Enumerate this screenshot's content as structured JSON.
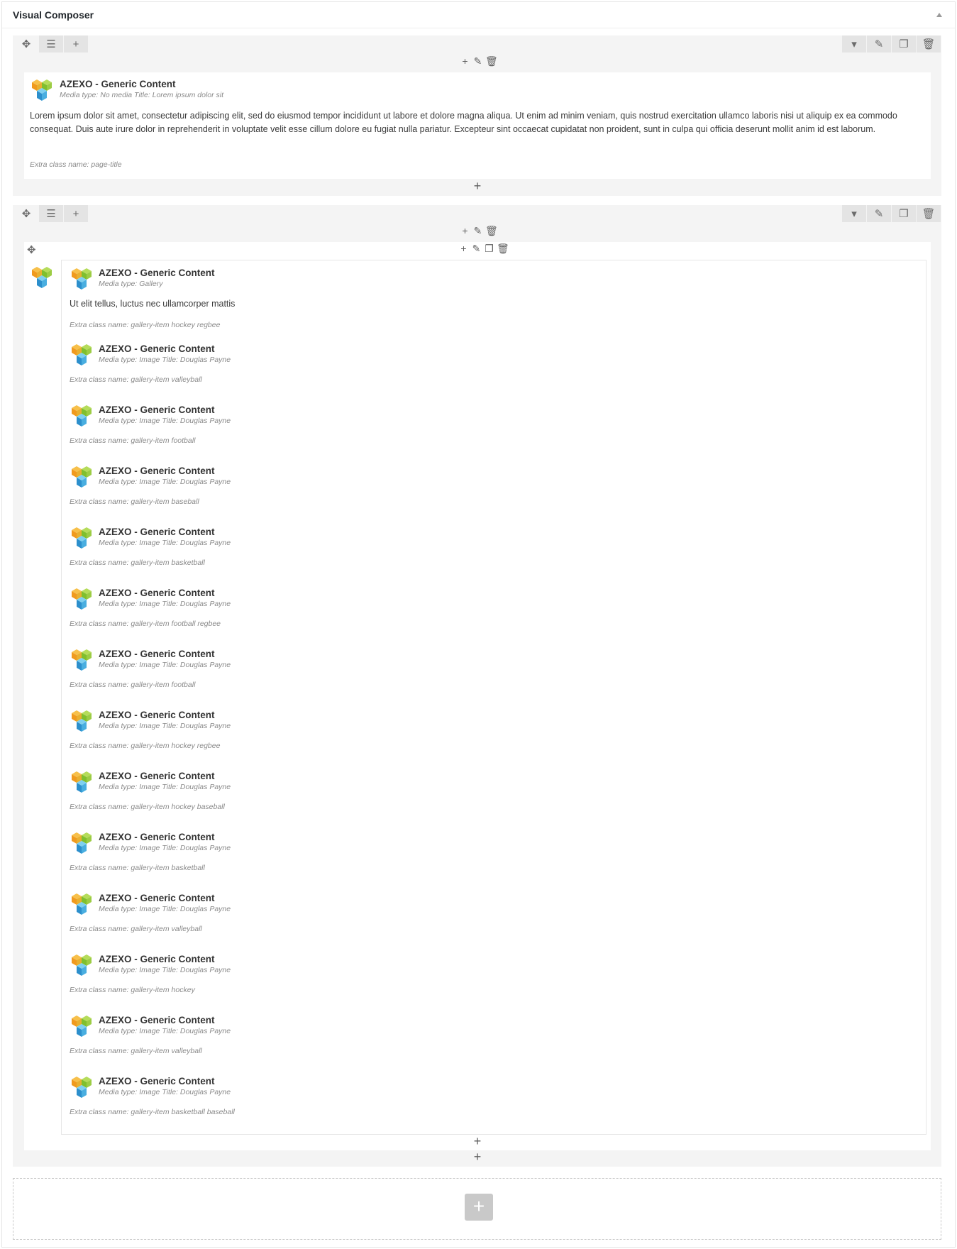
{
  "panel": {
    "title": "Visual Composer"
  },
  "icons": {
    "move": "move-arrows-icon",
    "layout": "row-layout-icon",
    "add": "plus-icon",
    "collapse": "chevron-down-icon",
    "edit": "pencil-icon",
    "clone": "clone-icon",
    "delete": "trash-icon",
    "logo": "vc-cube-logo-icon"
  },
  "colors": {
    "row_bg": "#f4f4f4",
    "button_bg": "#e4e4e4",
    "logo_orange": "#f6a623",
    "logo_green": "#8dc63f",
    "logo_blue": "#3aa0d6"
  },
  "row1": {
    "element": {
      "title": "AZEXO - Generic Content",
      "meta": "Media type: No media  Title: Lorem ipsum dolor sit",
      "text": "Lorem ipsum dolor sit amet, consectetur adipiscing elit, sed do eiusmod tempor incididunt ut labore et dolore magna aliqua. Ut enim ad minim veniam, quis nostrud exercitation ullamco laboris nisi ut aliquip ex ea commodo consequat. Duis aute irure dolor in reprehenderit in voluptate velit esse cillum dolore eu fugiat nulla pariatur. Excepteur sint occaecat cupidatat non proident, sunt in culpa qui officia deserunt mollit anim id est laborum.",
      "class": "Extra class name: page-title"
    }
  },
  "row2": {
    "gallery_head": {
      "title": "AZEXO - Generic Content",
      "meta": "Media type: Gallery",
      "text": "Ut elit tellus, luctus nec ullamcorper mattis",
      "class": "Extra class name: gallery-item hockey regbee"
    },
    "items": [
      {
        "title": "AZEXO - Generic Content",
        "meta": "Media type: Image  Title: Douglas Payne",
        "class": "Extra class name: gallery-item valleyball"
      },
      {
        "title": "AZEXO - Generic Content",
        "meta": "Media type: Image  Title: Douglas Payne",
        "class": "Extra class name: gallery-item football"
      },
      {
        "title": "AZEXO - Generic Content",
        "meta": "Media type: Image  Title: Douglas Payne",
        "class": "Extra class name: gallery-item baseball"
      },
      {
        "title": "AZEXO - Generic Content",
        "meta": "Media type: Image  Title: Douglas Payne",
        "class": "Extra class name: gallery-item basketball"
      },
      {
        "title": "AZEXO - Generic Content",
        "meta": "Media type: Image  Title: Douglas Payne",
        "class": "Extra class name: gallery-item football regbee"
      },
      {
        "title": "AZEXO - Generic Content",
        "meta": "Media type: Image  Title: Douglas Payne",
        "class": "Extra class name: gallery-item football"
      },
      {
        "title": "AZEXO - Generic Content",
        "meta": "Media type: Image  Title: Douglas Payne",
        "class": "Extra class name: gallery-item hockey regbee"
      },
      {
        "title": "AZEXO - Generic Content",
        "meta": "Media type: Image  Title: Douglas Payne",
        "class": "Extra class name: gallery-item hockey baseball"
      },
      {
        "title": "AZEXO - Generic Content",
        "meta": "Media type: Image  Title: Douglas Payne",
        "class": "Extra class name: gallery-item basketball"
      },
      {
        "title": "AZEXO - Generic Content",
        "meta": "Media type: Image  Title: Douglas Payne",
        "class": "Extra class name: gallery-item valleyball"
      },
      {
        "title": "AZEXO - Generic Content",
        "meta": "Media type: Image  Title: Douglas Payne",
        "class": "Extra class name: gallery-item hockey"
      },
      {
        "title": "AZEXO - Generic Content",
        "meta": "Media type: Image  Title: Douglas Payne",
        "class": "Extra class name: gallery-item valleyball"
      },
      {
        "title": "AZEXO - Generic Content",
        "meta": "Media type: Image  Title: Douglas Payne",
        "class": "Extra class name: gallery-item basketball baseball"
      }
    ]
  }
}
